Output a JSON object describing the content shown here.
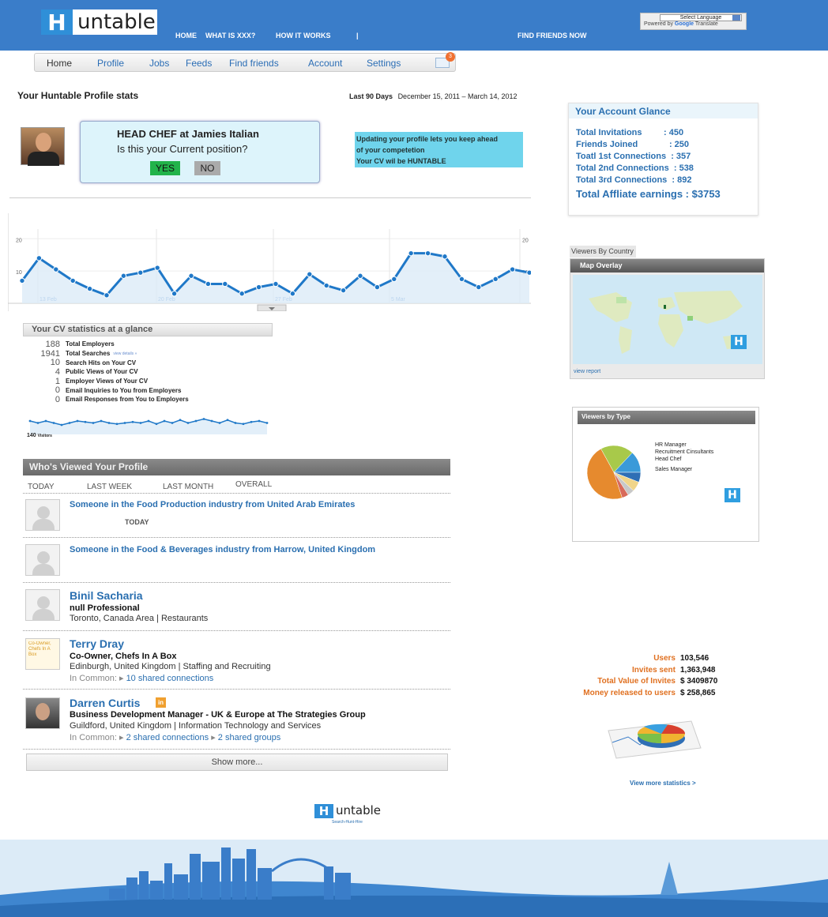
{
  "header": {
    "logo_h": "H",
    "logo_word": "untable",
    "nav": [
      "HOME",
      "WHAT IS XXX?",
      "HOW IT WORKS",
      "|",
      "FIND FRIENDS NOW"
    ],
    "language_select": "Select Language",
    "powered_by": "Powered by",
    "google": "Google",
    "translate": "Translate"
  },
  "tabs": [
    "Home",
    "Profile",
    "Jobs",
    "Feeds",
    "Find friends",
    "Account",
    "Settings"
  ],
  "mail_count": "3",
  "stats": {
    "title": "Your Huntable Profile stats",
    "range_label": "Last 90 Days",
    "range_value": "December 15, 2011 – March 14, 2012"
  },
  "position": {
    "title": "HEAD CHEF at Jamies Italian",
    "question": "Is this your Current position?",
    "yes": "YES",
    "no": "NO"
  },
  "update_box": [
    "Updating your profile lets you keep ahead",
    "of your competetion",
    "Your CV wil be HUNTABLE"
  ],
  "chart_data": {
    "type": "line",
    "x_ticks": [
      "13 Feb",
      "20 Feb",
      "27 Feb",
      "5 Mar"
    ],
    "y_ticks": [
      "20",
      "10"
    ],
    "ylim": [
      0,
      23
    ],
    "values": [
      7,
      14,
      10.5,
      7,
      4.5,
      2.5,
      8.5,
      9.5,
      11,
      3,
      8.5,
      6,
      6,
      3,
      5,
      6,
      3,
      9,
      5.5,
      4,
      8.5,
      5,
      7.5,
      15.5,
      15.5,
      14.5,
      7.5,
      5,
      7.5,
      10.5,
      9.5
    ]
  },
  "cv_stats": {
    "title": "Your CV statistics at a glance",
    "rows": [
      {
        "num": "188",
        "label": "Total Employers"
      },
      {
        "num": "1941",
        "label": "Total Searches"
      },
      {
        "num": "10",
        "label": "Search Hits on Your CV"
      },
      {
        "num": "4",
        "label": "Public Views of Your CV"
      },
      {
        "num": "1",
        "label": "Employer Views of Your CV"
      },
      {
        "num": "0",
        "label": "Email Inquiries to You from Employers"
      },
      {
        "num": "0",
        "label": "Email Responses from You to Employers"
      }
    ],
    "view_details": "view details »",
    "visitors_num": "140",
    "visitors_label": "Visitors",
    "mini_values": [
      6,
      5,
      6,
      5,
      4,
      5,
      6,
      5.5,
      5,
      6,
      5,
      4.5,
      5,
      5.5,
      5,
      6,
      4.5,
      6,
      5,
      6.5,
      5,
      6,
      7,
      6,
      5,
      6.5,
      5,
      4.5,
      5.5,
      6,
      5
    ]
  },
  "who_viewed": {
    "title": "Who's Viewed Your Profile",
    "tabs": [
      "TODAY",
      "LAST WEEK",
      "LAST MONTH",
      "OVERALL"
    ],
    "v1": "Someone in the Food Production industry from United Arab Emirates",
    "v1_when": "TODAY",
    "v2": "Someone in the Food & Beverages industry from Harrow, United Kingdom",
    "p3_name": "Binil Sacharia",
    "p3_title": "null Professional",
    "p3_loc": "Toronto, Canada Area | Restaurants",
    "p4_name": "Terry Dray",
    "p4_title": "Co-Owner, Chefs In A Box",
    "p4_loc": "Edinburgh, United Kingdom | Staffing and Recruiting",
    "in_common": "In Common:",
    "p4_common": "10 shared connections",
    "p5_name": "Darren Curtis",
    "p5_title": "Business Development Manager - UK & Europe at The Strategies Group",
    "p5_loc": "Guildford, United Kingdom | Information Technology and Services",
    "p5_common1": "2 shared connections",
    "p5_common2": "2 shared groups",
    "show_more": "Show more..."
  },
  "glance": {
    "title": "Your Account Glance",
    "rows": [
      "Total Invitations         : 450",
      "Friends Joined             : 250",
      "Toatl 1st Connections  : 357",
      "Total 2nd Connections  : 538",
      "Total 3rd Connections  : 892"
    ],
    "earnings": "Total Affliate earnings : $3753"
  },
  "country": {
    "tab": "Viewers By Country",
    "header": "Map Overlay",
    "view_report": "view report"
  },
  "viewers_type": {
    "title": "Viewers by Type",
    "labels": [
      "HR Manager",
      "Recruitment Cinsultants",
      "Head Chef",
      "Sales Manager"
    ],
    "colors": [
      "#e68a2e",
      "#a8c94a",
      "#3a9ad9",
      "#2f6fb5",
      "#f0d58a",
      "#c8c8c8",
      "#d86a5a"
    ]
  },
  "totals": [
    {
      "k": "Users",
      "v": "103,546"
    },
    {
      "k": "Invites sent",
      "v": "1,363,948"
    },
    {
      "k": "Total Value of Invites",
      "v": "$ 3409870"
    },
    {
      "k": "Money released to users",
      "v": "$ 258,865"
    }
  ],
  "view_more": "View more statistics >",
  "footer": {
    "logo_h": "H",
    "logo_word": "untable",
    "tagline": "Search-Hunt-Hire"
  }
}
